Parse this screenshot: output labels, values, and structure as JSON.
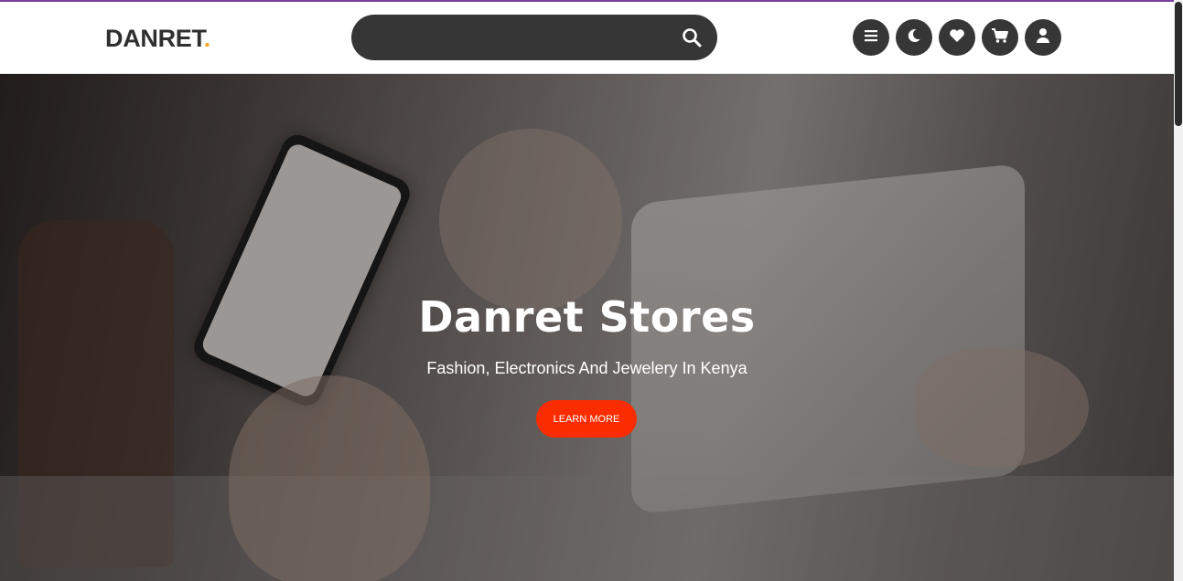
{
  "brand": {
    "name": "DANRET",
    "dot": ".",
    "accent_color": "#f5a623"
  },
  "search": {
    "placeholder": "",
    "icon": "search-icon"
  },
  "nav_icons": [
    "menu-icon",
    "moon-icon",
    "heart-icon",
    "cart-icon",
    "user-icon"
  ],
  "hero": {
    "title": "Danret Stores",
    "subtitle": "Fashion, Electronics And Jewelery In Kenya",
    "cta_label": "LEARN MORE",
    "cta_color": "#fb2d00"
  }
}
